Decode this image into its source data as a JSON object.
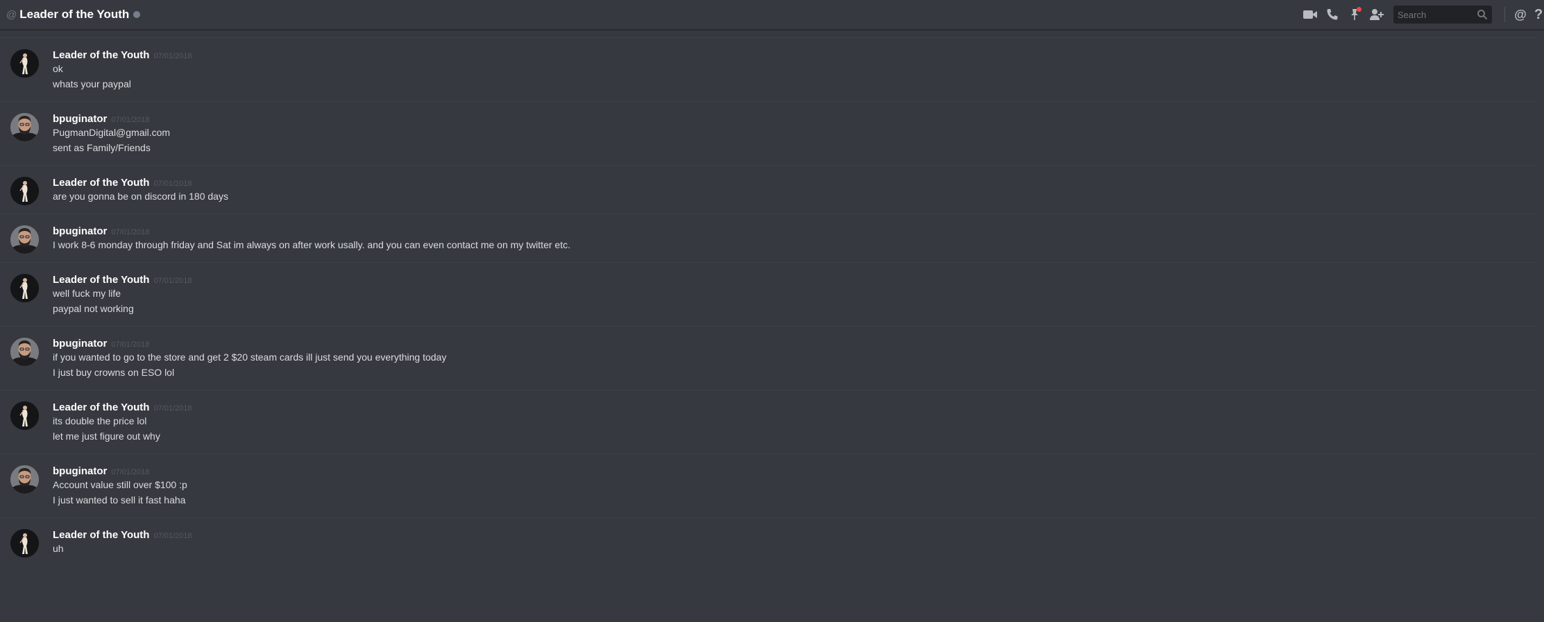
{
  "header": {
    "channel_name": "Leader of the Youth",
    "search_placeholder": "Search"
  },
  "icons": {
    "at": "@",
    "video": "video-call-icon",
    "call": "phone-icon",
    "pin": "pin-icon",
    "add_friend": "add-friend-icon",
    "search": "search-icon",
    "mentions": "@",
    "help": "?"
  },
  "colors": {
    "background": "#36393f",
    "username": "#ffffff",
    "timestamp": "#555a61",
    "pin_badge": "#f04747"
  },
  "messages": [
    {
      "author": "Leader of the Youth",
      "timestamp": "07/01/2018",
      "lines": [
        "ok",
        "whats your paypal"
      ]
    },
    {
      "author": "bpuginator",
      "timestamp": "07/01/2018",
      "lines": [
        "PugmanDigital@gmail.com",
        "sent as Family/Friends"
      ]
    },
    {
      "author": "Leader of the Youth",
      "timestamp": "07/01/2018",
      "lines": [
        "are you gonna be on discord in 180 days"
      ]
    },
    {
      "author": "bpuginator",
      "timestamp": "07/01/2018",
      "lines": [
        "I work 8-6 monday through friday and Sat im always on after work usally. and you can even contact me on my twitter etc."
      ]
    },
    {
      "author": "Leader of the Youth",
      "timestamp": "07/01/2018",
      "lines": [
        "well fuck my life",
        "paypal not working"
      ]
    },
    {
      "author": "bpuginator",
      "timestamp": "07/01/2018",
      "lines": [
        "if you wanted to go to the store and get 2 $20 steam cards ill just send you everything today",
        "I just buy crowns on ESO lol"
      ]
    },
    {
      "author": "Leader of the Youth",
      "timestamp": "07/01/2018",
      "lines": [
        "its double the price lol",
        "let me just figure out why"
      ]
    },
    {
      "author": "bpuginator",
      "timestamp": "07/01/2018",
      "lines": [
        "Account value still over $100 :p",
        "I just wanted to sell it fast haha"
      ]
    },
    {
      "author": "Leader of the Youth",
      "timestamp": "07/01/2018",
      "lines": [
        "uh"
      ]
    }
  ]
}
